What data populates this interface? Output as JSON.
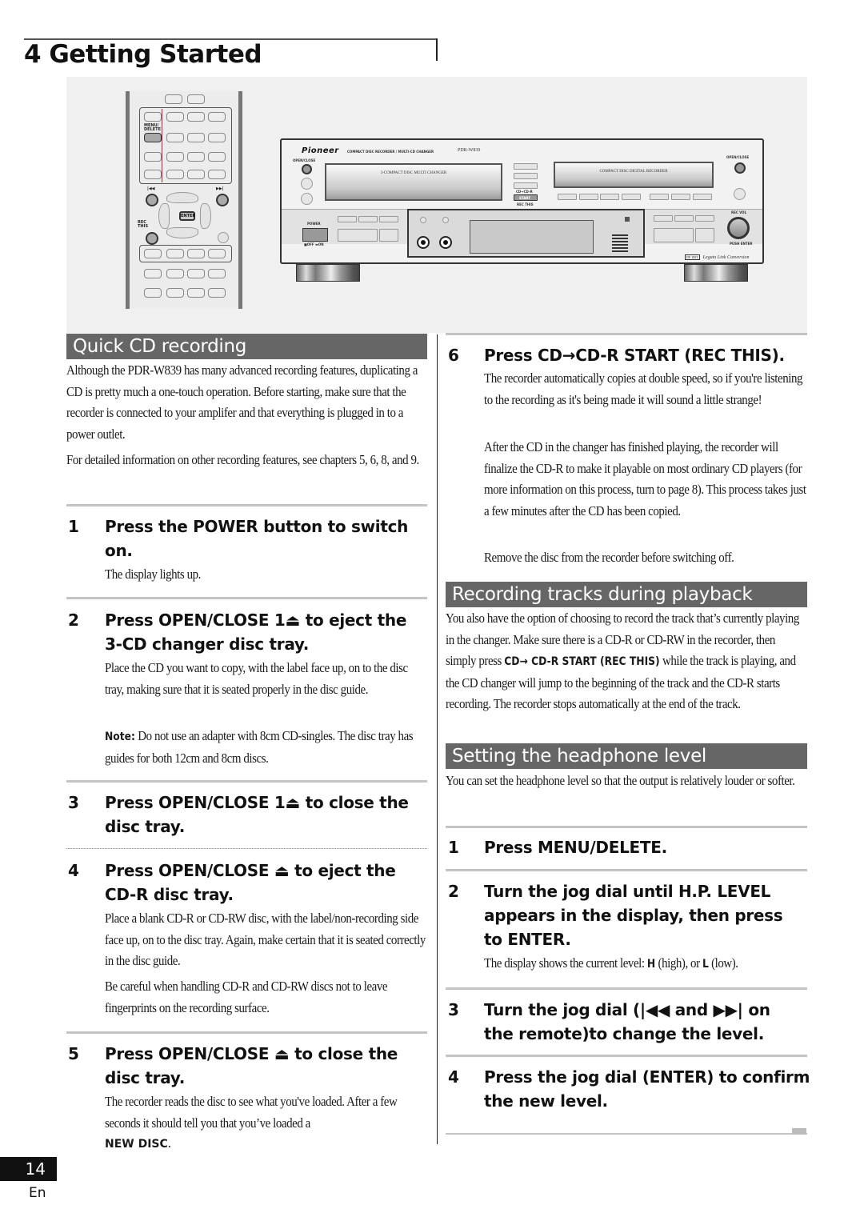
{
  "header": {
    "chapter_title": "4 Getting Started"
  },
  "illustration": {
    "remote": {
      "menu_delete_label": "MENU/ DELETE",
      "prev_label": "|◀◀",
      "next_label": "▶▶|",
      "enter_label": "ENTER",
      "rec_this_label": "REC THIS"
    },
    "recorder": {
      "brand": "Pioneer",
      "subtitle": "COMPACT DISC RECORDER / MULTI-CD CHANGER",
      "model": "PDR-W839",
      "open_close_left": "OPEN/CLOSE",
      "changer_tray_label": "3-COMPACT DISC MULTI CHANGER",
      "recorder_tray_label": "COMPACT DISC DIGITAL RECORDER",
      "open_close_right": "OPEN/CLOSE",
      "cd_to_cdr": "CD→CD-R",
      "start_label": "START",
      "rec_this": "REC THIS",
      "power_label": "POWER",
      "power_states": "■OFF ▬ON",
      "rec_vol_label": "REC VOL",
      "push_enter": "PUSH ENTER",
      "legato_badge": "DF 1BIT",
      "legato_text": "Legato Link Conversion"
    }
  },
  "left_column": {
    "section_title": "Quick CD recording",
    "intro_paragraphs": [
      "Although the PDR-W839 has many advanced recording features, duplicating a CD is pretty much a one-touch operation. Before starting, make sure that the recorder is connected to your amplifer and that everything is plugged in to a power outlet.",
      "For detailed information on other recording features, see chapters 5, 6, 8, and 9."
    ],
    "steps": [
      {
        "num": "1",
        "title": "Press the POWER button to switch on.",
        "body": [
          "The display lights up."
        ]
      },
      {
        "num": "2",
        "title": "Press OPEN/CLOSE 1⏏ to eject the 3-CD changer disc tray.",
        "body": [
          "Place the CD you want to copy, with the label face up, on to the disc tray, making sure that it is seated properly in the disc guide."
        ],
        "note_label": "Note:",
        "note_text": " Do not use an adapter with 8cm CD-singles. The disc tray has guides for both 12cm and 8cm discs."
      },
      {
        "num": "3",
        "title": "Press OPEN/CLOSE 1⏏ to close the disc tray."
      },
      {
        "num": "4",
        "title": "Press OPEN/CLOSE ⏏ to eject the CD-R disc tray.",
        "body": [
          "Place a blank CD-R or CD-RW disc, with the label/non-recording side face up, on to the disc tray. Again, make certain that it is seated correctly in the disc guide.",
          "Be careful when handling CD-R and CD-RW discs not to leave fingerprints on the recording surface."
        ]
      },
      {
        "num": "5",
        "title": "Press OPEN/CLOSE ⏏ to close the disc tray.",
        "body": [
          "The recorder reads the disc to see what you've loaded. After a few seconds it should tell you that you’ve loaded a"
        ],
        "display_text": "NEW DISC",
        "display_suffix": "."
      }
    ]
  },
  "right_column": {
    "step6": {
      "num": "6",
      "title": "Press CD→CD-R START (REC THIS).",
      "body": [
        "The recorder automatically copies at double speed, so if you're listening to the recording as it's being made it will sound a little strange!",
        "After the CD in the changer has finished playing, the recorder will finalize the CD-R to make it playable on most ordinary CD players (for more information on this process, turn to page 8). This process takes just a few minutes after the CD has been copied.",
        "Remove the disc from the recorder before switching off."
      ]
    },
    "recording_section": {
      "title": "Recording tracks during playback",
      "text_before": "You also have the option of choosing to record the track that’s currently playing in the changer. Make sure there is a CD-R or CD-RW in the recorder, then simply press ",
      "button_text": "CD→ CD-R START (REC THIS)",
      "text_after": " while the track is playing, and the CD changer will jump to the beginning of the track and the CD-R starts recording. The recorder stops automatically at the end of the track."
    },
    "headphone_section": {
      "title": "Setting the headphone level",
      "intro": "You can set the headphone level so that the output is relatively louder or softer.",
      "steps": [
        {
          "num": "1",
          "title": "Press MENU/DELETE."
        },
        {
          "num": "2",
          "title": "Turn the jog dial until H.P. LEVEL appears in the display, then press to ENTER.",
          "body_pre": "The display shows the current level: ",
          "level_high": "H",
          "high_text": " (high), or ",
          "level_low": "L",
          "low_text": " (low)."
        },
        {
          "num": "3",
          "title": "Turn the jog dial (|◀◀ and ▶▶| on the remote)to change the level."
        },
        {
          "num": "4",
          "title": "Press the jog dial (ENTER) to confirm the new level."
        }
      ]
    }
  },
  "footer": {
    "page_number": "14",
    "language": "En"
  }
}
